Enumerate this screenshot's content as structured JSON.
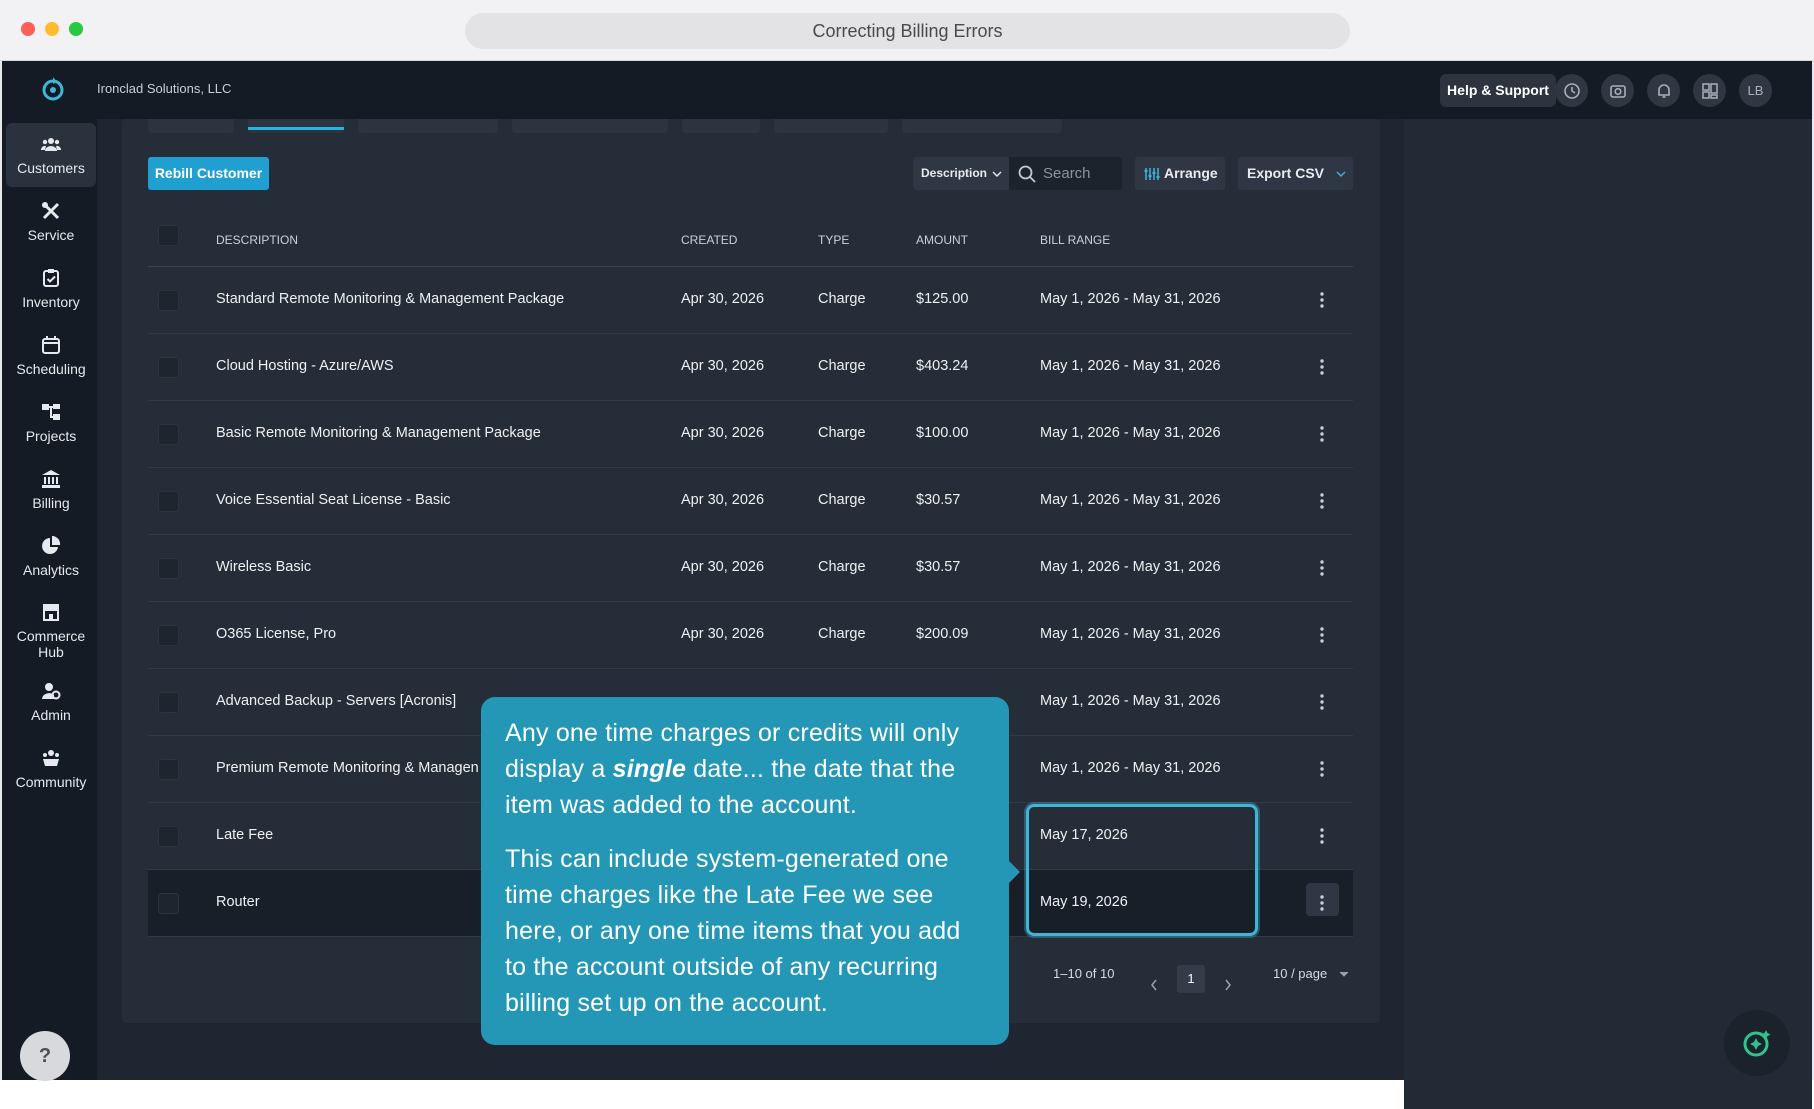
{
  "window": {
    "title": "Correcting Billing Errors"
  },
  "topnav": {
    "company": "Ironclad Solutions, LLC",
    "help_label": "Help & Support",
    "avatar_initials": "LB",
    "icons": [
      "history-icon",
      "camera-icon",
      "bell-icon",
      "dashboard-icon"
    ]
  },
  "sidebar": {
    "items": [
      {
        "label": "Customers",
        "icon": "users-icon",
        "active": true
      },
      {
        "label": "Service",
        "icon": "tools-icon"
      },
      {
        "label": "Inventory",
        "icon": "clipboard-check-icon"
      },
      {
        "label": "Scheduling",
        "icon": "calendar-icon"
      },
      {
        "label": "Projects",
        "icon": "hierarchy-icon"
      },
      {
        "label": "Billing",
        "icon": "bank-icon"
      },
      {
        "label": "Analytics",
        "icon": "pie-chart-icon"
      },
      {
        "label": "Commerce Hub",
        "icon": "storefront-icon"
      },
      {
        "label": "Admin",
        "icon": "user-gear-icon"
      },
      {
        "label": "Community",
        "icon": "community-icon"
      }
    ],
    "help_glyph": "?"
  },
  "toolbar": {
    "rebill_label": "Rebill Customer",
    "filter_field": "Description",
    "search_placeholder": "Search",
    "arrange_label": "Arrange",
    "export_label": "Export CSV"
  },
  "table": {
    "columns": [
      "DESCRIPTION",
      "CREATED",
      "TYPE",
      "AMOUNT",
      "BILL RANGE"
    ],
    "rows": [
      {
        "description": "Standard Remote Monitoring & Management Package",
        "created": "Apr 30, 2026",
        "type": "Charge",
        "amount": "$125.00",
        "bill_range": "May 1, 2026 - May 31, 2026"
      },
      {
        "description": "Cloud Hosting - Azure/AWS",
        "created": "Apr 30, 2026",
        "type": "Charge",
        "amount": "$403.24",
        "bill_range": "May 1, 2026 - May 31, 2026"
      },
      {
        "description": "Basic Remote Monitoring & Management Package",
        "created": "Apr 30, 2026",
        "type": "Charge",
        "amount": "$100.00",
        "bill_range": "May 1, 2026 - May 31, 2026"
      },
      {
        "description": "Voice Essential Seat License - Basic",
        "created": "Apr 30, 2026",
        "type": "Charge",
        "amount": "$30.57",
        "bill_range": "May 1, 2026 - May 31, 2026"
      },
      {
        "description": "Wireless Basic",
        "created": "Apr 30, 2026",
        "type": "Charge",
        "amount": "$30.57",
        "bill_range": "May 1, 2026 - May 31, 2026"
      },
      {
        "description": "O365 License, Pro",
        "created": "Apr 30, 2026",
        "type": "Charge",
        "amount": "$200.09",
        "bill_range": "May 1, 2026 - May 31, 2026"
      },
      {
        "description": "Advanced Backup - Servers [Acronis]",
        "created": "",
        "type": "",
        "amount": "",
        "bill_range": "May 1, 2026 - May 31, 2026"
      },
      {
        "description": "Premium Remote Monitoring & Managen",
        "created": "",
        "type": "",
        "amount": "",
        "bill_range": "May 1, 2026 - May 31, 2026"
      },
      {
        "description": "Late Fee",
        "created": "",
        "type": "",
        "amount": "",
        "bill_range": "May 17, 2026"
      },
      {
        "description": "Router",
        "created": "",
        "type": "",
        "amount": "",
        "bill_range": "May 19, 2026"
      }
    ]
  },
  "pagination": {
    "range_text": "1–10 of 10",
    "current_page": "1",
    "page_size": "10 / page"
  },
  "tooltip": {
    "p1_before": "Any one time charges or credits will only display a ",
    "p1_emph": "single",
    "p1_after": " date... the date that the item was added to the account.",
    "p2": "This can include system-generated one time charges like the Late Fee we see here, or any one time items that you add to the account outside of any recurring billing set up on the account."
  },
  "colors": {
    "accent": "#1fa0d0",
    "tooltip_bg": "#2497b7",
    "app_bg": "#1f2631",
    "nav_bg": "#151b24"
  }
}
